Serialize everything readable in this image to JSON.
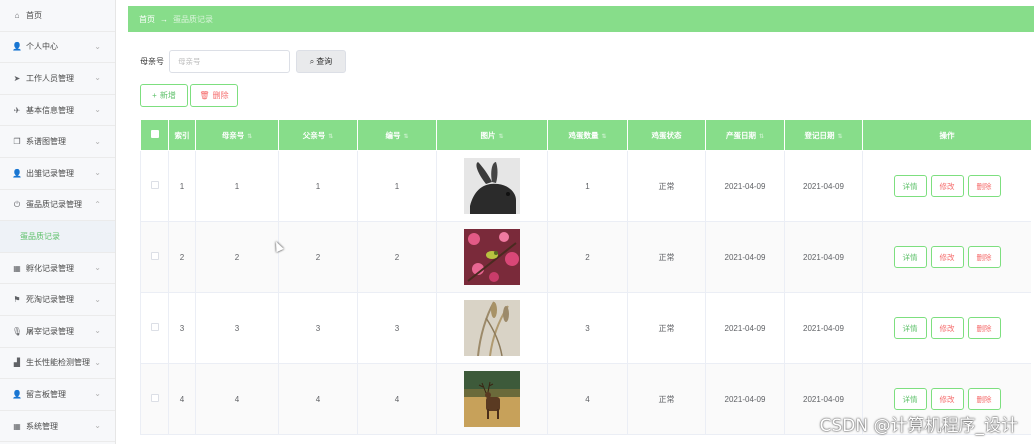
{
  "sidebar": {
    "items": [
      {
        "label": "首页",
        "icon": "home-icon",
        "glyph": "⌂",
        "chevron": ""
      },
      {
        "label": "个人中心",
        "icon": "user-icon",
        "glyph": "👤",
        "chevron": "⌄"
      },
      {
        "label": "工作人员管理",
        "icon": "send-icon",
        "glyph": "➤",
        "chevron": "⌄"
      },
      {
        "label": "基本信息管理",
        "icon": "plane-icon",
        "glyph": "✈",
        "chevron": "⌄"
      },
      {
        "label": "系谱图管理",
        "icon": "copy-icon",
        "glyph": "❐",
        "chevron": "⌄"
      },
      {
        "label": "出雏记录管理",
        "icon": "person-icon",
        "glyph": "👤",
        "chevron": "⌄"
      },
      {
        "label": "蛋品质记录管理",
        "icon": "power-icon",
        "glyph": "⏻",
        "chevron": "⌃"
      },
      {
        "label": "孵化记录管理",
        "icon": "grid-icon",
        "glyph": "▦",
        "chevron": "⌄"
      },
      {
        "label": "死淘记录管理",
        "icon": "flag-icon",
        "glyph": "⚑",
        "chevron": "⌄"
      },
      {
        "label": "屠宰记录管理",
        "icon": "microphone-icon",
        "glyph": "🎙",
        "chevron": "⌄"
      },
      {
        "label": "生长性能检测管理",
        "icon": "chart-icon",
        "glyph": "▟",
        "chevron": "⌄"
      },
      {
        "label": "留言板管理",
        "icon": "user-icon",
        "glyph": "👤",
        "chevron": "⌄"
      },
      {
        "label": "系统管理",
        "icon": "table-icon",
        "glyph": "▦",
        "chevron": "⌄"
      }
    ],
    "sub_item": "蛋品质记录"
  },
  "breadcrumb": {
    "home": "首页",
    "arrow": "→",
    "current": "蛋品质记录"
  },
  "search": {
    "label": "母亲号",
    "placeholder": "母亲号",
    "value": "",
    "button": "查询",
    "button_icon": "search-icon"
  },
  "actions": {
    "add": "新增",
    "add_icon": "+",
    "delete": "删除",
    "delete_icon": "🗑"
  },
  "table": {
    "headers": [
      "索引",
      "母亲号",
      "父亲号",
      "编号",
      "图片",
      "鸡蛋数量",
      "鸡蛋状态",
      "产蛋日期",
      "登记日期",
      "操作"
    ],
    "rows": [
      {
        "index": "1",
        "mother": "1",
        "father": "1",
        "number": "1",
        "image": "rabbit-photo",
        "eggs": "1",
        "status": "正常",
        "lay_date": "2021-04-09",
        "reg_date": "2021-04-09"
      },
      {
        "index": "2",
        "mother": "2",
        "father": "2",
        "number": "2",
        "image": "bird-blossom-photo",
        "eggs": "2",
        "status": "正常",
        "lay_date": "2021-04-09",
        "reg_date": "2021-04-09"
      },
      {
        "index": "3",
        "mother": "3",
        "father": "3",
        "number": "3",
        "image": "grass-photo",
        "eggs": "3",
        "status": "正常",
        "lay_date": "2021-04-09",
        "reg_date": "2021-04-09"
      },
      {
        "index": "4",
        "mother": "4",
        "father": "4",
        "number": "4",
        "image": "deer-photo",
        "eggs": "4",
        "status": "正常",
        "lay_date": "2021-04-09",
        "reg_date": "2021-04-09"
      }
    ],
    "op_labels": {
      "detail": "详情",
      "edit": "修改",
      "remove": "删除"
    }
  },
  "watermark": "CSDN @计算机程序_设计",
  "colors": {
    "accent": "#87dd8a",
    "accent_text": "#5fc16b",
    "danger": "#f56c6c"
  }
}
